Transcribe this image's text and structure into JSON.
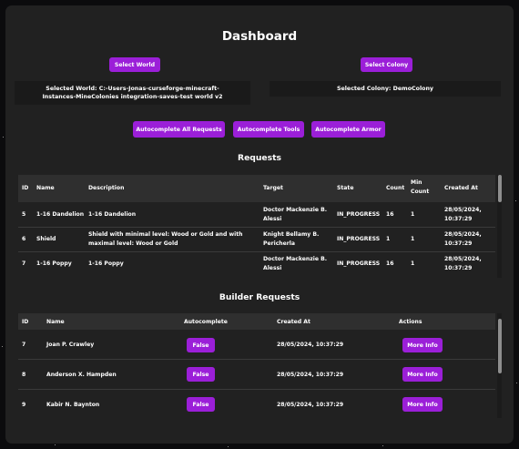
{
  "dashboard": {
    "title": "Dashboard",
    "select_world_label": "Select World",
    "select_colony_label": "Select Colony",
    "selected_world_text": "Selected World: C:-Users-Jonas-curseforge-minecraft-Instances-MineColonies integration-saves-test world v2",
    "selected_colony_text": "Selected Colony: DemoColony",
    "autocomplete_all_label": "Autocomplete All Requests",
    "autocomplete_tools_label": "Autocomplete Tools",
    "autocomplete_armor_label": "Autocomplete Armor"
  },
  "requests": {
    "title": "Requests",
    "headers": {
      "id": "ID",
      "name": "Name",
      "description": "Description",
      "target": "Target",
      "state": "State",
      "count": "Count",
      "min_count": "Min Count",
      "created_at": "Created At"
    },
    "rows": [
      {
        "id": "5",
        "name": "1-16 Dandelion",
        "description": "1-16 Dandelion",
        "target": "Doctor Mackenzie B. Alessi",
        "state": "IN_PROGRESS",
        "count": "16",
        "min_count": "1",
        "created_at": "28/05/2024, 10:37:29"
      },
      {
        "id": "6",
        "name": "Shield",
        "description": "Shield with minimal level: Wood or Gold and with maximal level: Wood or Gold",
        "target": "Knight Bellamy B. Pericherla",
        "state": "IN_PROGRESS",
        "count": "1",
        "min_count": "1",
        "created_at": "28/05/2024, 10:37:29"
      },
      {
        "id": "7",
        "name": "1-16 Poppy",
        "description": "1-16 Poppy",
        "target": "Doctor Mackenzie B. Alessi",
        "state": "IN_PROGRESS",
        "count": "16",
        "min_count": "1",
        "created_at": "28/05/2024, 10:37:29"
      }
    ]
  },
  "builder_requests": {
    "title": "Builder Requests",
    "headers": {
      "id": "ID",
      "name": "Name",
      "autocomplete": "Autocomplete",
      "created_at": "Created At",
      "actions": "Actions"
    },
    "rows": [
      {
        "id": "7",
        "name": "Joan P. Crawley",
        "autocomplete": "False",
        "created_at": "28/05/2024, 10:37:29",
        "action": "More Info"
      },
      {
        "id": "8",
        "name": "Anderson X. Hampden",
        "autocomplete": "False",
        "created_at": "28/05/2024, 10:37:29",
        "action": "More Info"
      },
      {
        "id": "9",
        "name": "Kabir N. Baynton",
        "autocomplete": "False",
        "created_at": "28/05/2024, 10:37:29",
        "action": "More Info"
      }
    ]
  },
  "colors": {
    "accent": "#9b1fd8",
    "panel": "#212121",
    "background": "#0b0b0d"
  }
}
